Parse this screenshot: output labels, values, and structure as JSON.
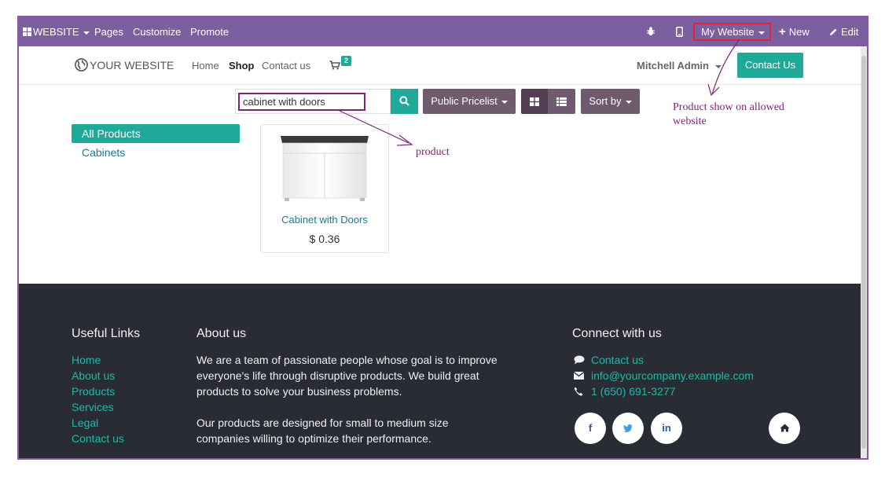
{
  "admin_bar": {
    "website_menu": "WEBSITE",
    "pages": "Pages",
    "customize": "Customize",
    "promote": "Promote",
    "current_website": "My Website",
    "new": "New",
    "edit": "Edit"
  },
  "site_header": {
    "logo_text": "YOUR WEBSITE",
    "nav": [
      "Home",
      "Shop",
      "Contact us"
    ],
    "active_nav": "Shop",
    "cart_count": "2",
    "user": "Mitchell Admin",
    "contact_button": "Contact Us"
  },
  "shop": {
    "search_value": "cabinet with doors",
    "pricelist": "Public Pricelist",
    "sort": "Sort by",
    "categories": [
      "All Products",
      "Cabinets"
    ],
    "selected_category": "All Products",
    "products": [
      {
        "name": "Cabinet with Doors",
        "price": "$ 0.36"
      }
    ]
  },
  "footer": {
    "useful_links_title": "Useful Links",
    "useful_links": [
      "Home",
      "About us",
      "Products",
      "Services",
      "Legal",
      "Contact us"
    ],
    "about_title": "About us",
    "about_lines": [
      "We are a team of passionate people whose goal is to improve",
      "everyone's life through disruptive products. We build great",
      "products to solve your business problems.",
      "",
      "Our products are designed for small to medium size",
      "companies willing to optimize their performance."
    ],
    "connect_title": "Connect with us",
    "contact_us": "Contact us",
    "email": "info@yourcompany.example.com",
    "phone": "1 (650) 691-3277",
    "social": [
      "f",
      "t",
      "in"
    ]
  },
  "annotations": {
    "product_label": "product",
    "website_note_line1": "Product show on allowed",
    "website_note_line2": "website"
  },
  "colors": {
    "admin_bar": "#7c5fa0",
    "accent": "#1fa998",
    "footer_bg": "#292c34",
    "annotation": "#7b2478",
    "highlight_box": "#e0243a"
  }
}
